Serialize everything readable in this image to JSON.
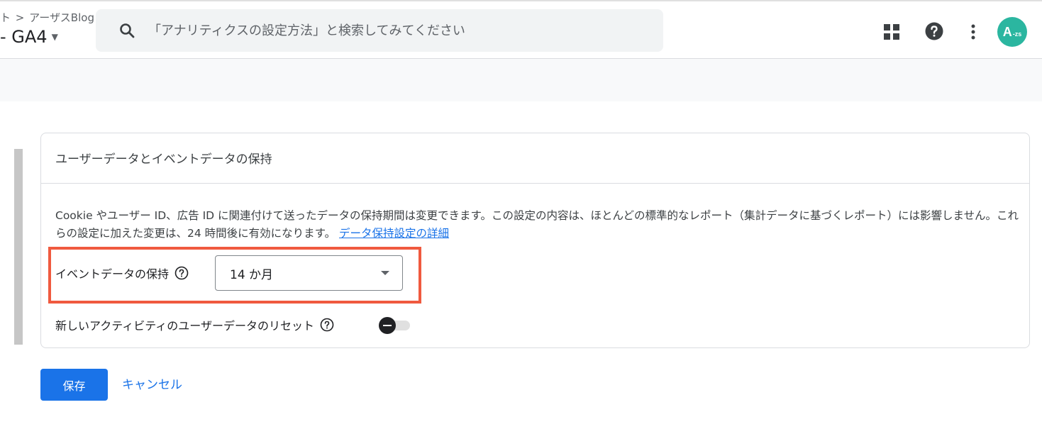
{
  "header": {
    "breadcrumb_prefix": "ト",
    "breadcrumb_sep": ">",
    "breadcrumb_item": "アーザスBlog",
    "property_name": "- GA4",
    "search_placeholder": "「アナリティクスの設定方法」と検索してみてください",
    "icons": [
      "apps-icon",
      "help-icon",
      "more-vert-icon"
    ],
    "avatar_text": "A",
    "avatar_sub": "-zs"
  },
  "card": {
    "title": "ユーザーデータとイベントデータの保持",
    "description": "Cookie やユーザー ID、広告 ID に関連付けて送ったデータの保持期間は変更できます。この設定の内容は、ほとんどの標準的なレポート（集計データに基づくレポート）には影響しません。これらの設定に加えた変更は、24 時間後に有効になります。",
    "description_link": "データ保持設定の詳細",
    "event_retention_label": "イベントデータの保持",
    "event_retention_value": "14 か月",
    "reset_label": "新しいアクティビティのユーザーデータのリセット"
  },
  "actions": {
    "save_label": "保存",
    "cancel_label": "キャンセル"
  },
  "colors": {
    "primary": "#1a73e8",
    "highlight": "#f05a3f",
    "avatar": "#2bb6a0"
  }
}
